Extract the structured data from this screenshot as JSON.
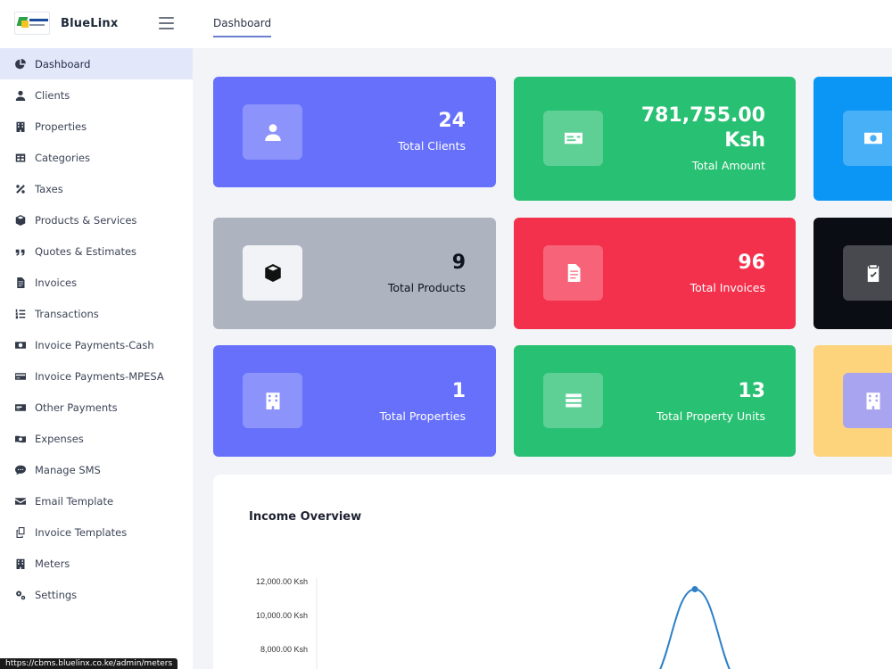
{
  "header": {
    "brand_name": "BlueLinx",
    "active_tab": "Dashboard"
  },
  "sidebar": {
    "items": [
      {
        "label": "Dashboard",
        "icon": "pie-chart-icon",
        "active": true
      },
      {
        "label": "Clients",
        "icon": "user-icon"
      },
      {
        "label": "Properties",
        "icon": "building-icon"
      },
      {
        "label": "Categories",
        "icon": "table-icon"
      },
      {
        "label": "Taxes",
        "icon": "percent-icon"
      },
      {
        "label": "Products & Services",
        "icon": "box-icon"
      },
      {
        "label": "Quotes & Estimates",
        "icon": "quote-icon"
      },
      {
        "label": "Invoices",
        "icon": "file-invoice-icon"
      },
      {
        "label": "Transactions",
        "icon": "list-ordered-icon"
      },
      {
        "label": "Invoice Payments-Cash",
        "icon": "money-bill-icon"
      },
      {
        "label": "Invoice Payments-MPESA",
        "icon": "credit-card-icon"
      },
      {
        "label": "Other Payments",
        "icon": "money-check-icon"
      },
      {
        "label": "Expenses",
        "icon": "money-bill-wave-icon"
      },
      {
        "label": "Manage SMS",
        "icon": "sms-icon"
      },
      {
        "label": "Email Template",
        "icon": "envelope-icon"
      },
      {
        "label": "Invoice Templates",
        "icon": "copy-icon"
      },
      {
        "label": "Meters",
        "icon": "meter-icon"
      },
      {
        "label": "Settings",
        "icon": "cogs-icon"
      }
    ]
  },
  "cards": [
    {
      "value": "24",
      "label": "Total Clients",
      "icon": "user-icon",
      "color": "#6670fb"
    },
    {
      "value": "781,755.00 Ksh",
      "value_line1": "781,755.00",
      "value_line2": "Ksh",
      "label": "Total Amount",
      "icon": "id-card-icon",
      "color": "#28c072"
    },
    {
      "icon": "money-bill-icon",
      "color": "#0b96f5"
    },
    {
      "value": "9",
      "label": "Total Products",
      "icon": "cube-icon",
      "color": "#aeb4bf"
    },
    {
      "value": "96",
      "label": "Total Invoices",
      "icon": "file-invoice-icon",
      "color": "#f4314c"
    },
    {
      "icon": "clipboard-check-icon",
      "color": "#0a0d14"
    },
    {
      "value": "1",
      "label": "Total Properties",
      "icon": "building-icon",
      "color": "#6670fb"
    },
    {
      "value": "13",
      "label": "Total Property Units",
      "icon": "list-icon",
      "color": "#28c072"
    },
    {
      "icon": "building-icon",
      "color": "#fdd47c"
    }
  ],
  "income_panel": {
    "title": "Income Overview"
  },
  "chart_data": {
    "type": "line",
    "title": "Income Overview",
    "ytick_labels": [
      "12,000.00 Ksh",
      "10,000.00 Ksh",
      "8,000.00 Ksh"
    ],
    "series_color": "#2f80c8",
    "peak_value": 11500
  },
  "statusbar": {
    "url": "https://cbms.bluelinx.co.ke/admin/meters"
  }
}
